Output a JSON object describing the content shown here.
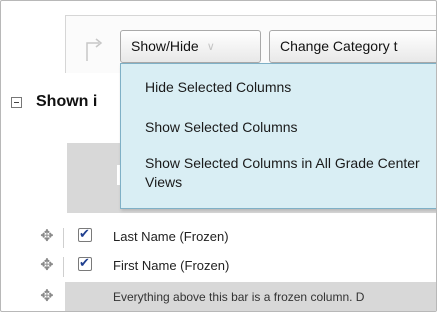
{
  "toolbar": {
    "show_hide_label": "Show/Hide",
    "change_category_label": "Change Category t"
  },
  "section": {
    "title": "Shown i"
  },
  "menu": {
    "items": [
      {
        "label": "Hide Selected Columns"
      },
      {
        "label": "Show Selected Columns"
      },
      {
        "label": "Show Selected Columns in All Grade Center Views"
      }
    ]
  },
  "rows": [
    {
      "label": "Last Name (Frozen)",
      "checked": true
    },
    {
      "label": "First Name (Frozen)",
      "checked": true
    }
  ],
  "frozen_note": "Everything above this bar is a frozen column. D",
  "icons": {
    "arrow": "turn-arrow-icon",
    "collapse": "collapse-icon",
    "drag": "drag-handle-icon",
    "chevron": "chevron-down-icon"
  },
  "colors": {
    "menu_bg": "#d9eef4",
    "menu_border": "#7fb0c6",
    "band_grey": "#d8d8d8",
    "check_blue": "#1f3f8f"
  }
}
